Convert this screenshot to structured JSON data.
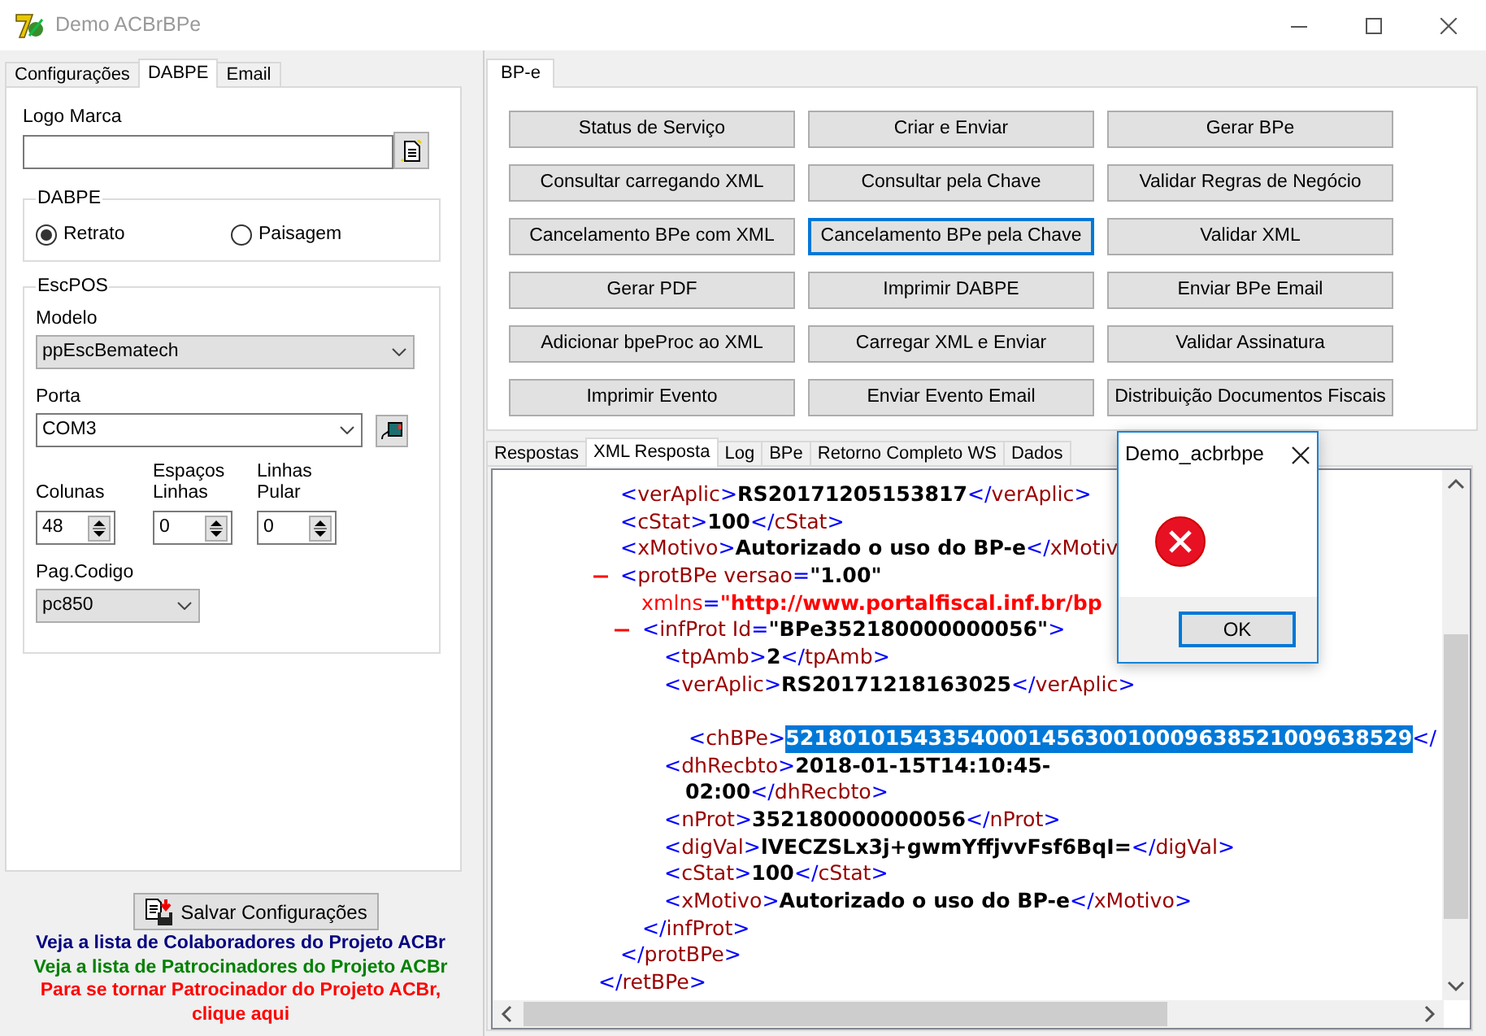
{
  "window": {
    "title": "Demo ACBrBPe",
    "active": false
  },
  "left_tabs": [
    {
      "label": "Configurações",
      "selected": false
    },
    {
      "label": "DABPE",
      "selected": true
    },
    {
      "label": "Email",
      "selected": false
    }
  ],
  "logo_field": {
    "label": "Logo Marca"
  },
  "orientation_group": {
    "title": "DABPE",
    "options": [
      {
        "label": "Retrato",
        "selected": true
      },
      {
        "label": "Paisagem",
        "selected": false
      }
    ]
  },
  "escpos": {
    "title": "EscPOS",
    "modelo": {
      "label": "Modelo",
      "value": "ppEscBematech"
    },
    "porta": {
      "label": "Porta",
      "value": "COM3"
    },
    "spinners": [
      {
        "label": "Colunas",
        "value": "48"
      },
      {
        "label": "Espaços Linhas",
        "value": "0"
      },
      {
        "label": "Linhas Pular",
        "value": "0"
      }
    ],
    "pag_codigo": {
      "label": "Pag.Codigo",
      "value": "pc850"
    }
  },
  "save_button": "Salvar Configurações",
  "links": [
    {
      "text": "Veja a lista de Colaboradores do Projeto ACBr",
      "color": "#000080"
    },
    {
      "text": "Veja a lista de Patrocinadores do Projeto ACBr",
      "color": "#008000"
    },
    {
      "text": "Para se tornar Patrocinador do Projeto ACBr, clique aqui",
      "color": "#ff0000"
    }
  ],
  "bpe_tabs": [
    {
      "label": "BP-e",
      "selected": true
    }
  ],
  "actions": [
    {
      "label": "Status de Serviço",
      "focused": false
    },
    {
      "label": "Criar e Enviar",
      "focused": false
    },
    {
      "label": "Gerar BPe",
      "focused": false
    },
    {
      "label": "Consultar carregando XML",
      "focused": false
    },
    {
      "label": "Consultar pela Chave",
      "focused": false
    },
    {
      "label": "Validar Regras de Negócio",
      "focused": false
    },
    {
      "label": "Cancelamento BPe com XML",
      "focused": false
    },
    {
      "label": "Cancelamento BPe pela Chave",
      "focused": true
    },
    {
      "label": "Validar XML",
      "focused": false
    },
    {
      "label": "Gerar PDF",
      "focused": false
    },
    {
      "label": "Imprimir DABPE",
      "focused": false
    },
    {
      "label": "Enviar BPe Email",
      "focused": false
    },
    {
      "label": "Adicionar bpeProc ao XML",
      "focused": false
    },
    {
      "label": "Carregar XML e Enviar",
      "focused": false
    },
    {
      "label": "Validar Assinatura",
      "focused": false
    },
    {
      "label": "Imprimir Evento",
      "focused": false
    },
    {
      "label": "Enviar Evento Email",
      "focused": false
    },
    {
      "label": "Distribuição Documentos Fiscais",
      "focused": false
    }
  ],
  "result_tabs": [
    {
      "label": "Respostas",
      "selected": false
    },
    {
      "label": "XML Resposta",
      "selected": true
    },
    {
      "label": "Log",
      "selected": false
    },
    {
      "label": "BPe",
      "selected": false
    },
    {
      "label": "Retorno Completo WS",
      "selected": false
    },
    {
      "label": "Dados",
      "selected": false
    }
  ],
  "xml": {
    "children": [
      {
        "lines": [
          [
            {
              "kind": "punct",
              "text": "<"
            },
            {
              "kind": "name",
              "text": "verAplic"
            },
            {
              "kind": "punct",
              "text": ">"
            },
            {
              "kind": "value",
              "text": "RS20171205153817"
            },
            {
              "kind": "punct",
              "text": "</"
            },
            {
              "kind": "name",
              "text": "verAplic"
            },
            {
              "kind": "punct",
              "text": ">"
            }
          ]
        ]
      },
      {
        "lines": [
          [
            {
              "kind": "punct",
              "text": "<"
            },
            {
              "kind": "name",
              "text": "cStat"
            },
            {
              "kind": "punct",
              "text": ">"
            },
            {
              "kind": "value",
              "text": "100"
            },
            {
              "kind": "punct",
              "text": "</"
            },
            {
              "kind": "name",
              "text": "cStat"
            },
            {
              "kind": "punct",
              "text": ">"
            }
          ]
        ]
      },
      {
        "lines": [
          [
            {
              "kind": "punct",
              "text": "<"
            },
            {
              "kind": "name",
              "text": "xMotivo"
            },
            {
              "kind": "punct",
              "text": ">"
            },
            {
              "kind": "value",
              "text": "Autorizado o uso do BP-e"
            },
            {
              "kind": "punct",
              "text": "</"
            },
            {
              "kind": "name",
              "text": "xMotiv"
            }
          ]
        ]
      },
      {
        "expanded": true,
        "lines": [
          [
            {
              "kind": "punct",
              "text": "<"
            },
            {
              "kind": "name",
              "text": "protBPe"
            },
            {
              "kind": "name",
              "text": " versao"
            },
            {
              "kind": "punct",
              "text": "="
            },
            {
              "kind": "value",
              "text": "\"1.00\""
            }
          ],
          [
            {
              "kind": "ns",
              "text": "xmlns"
            },
            {
              "kind": "punct",
              "text": "="
            },
            {
              "kind": "nsvalue",
              "text": "\"http://www.portalfiscal.inf.br/bp"
            }
          ]
        ],
        "children": [
          {
            "expanded": true,
            "lines": [
              [
                {
                  "kind": "punct",
                  "text": "<"
                },
                {
                  "kind": "name",
                  "text": "infProt"
                },
                {
                  "kind": "name",
                  "text": " Id"
                },
                {
                  "kind": "punct",
                  "text": "="
                },
                {
                  "kind": "value",
                  "text": "\"BPe352180000000056\""
                },
                {
                  "kind": "punct",
                  "text": ">"
                }
              ]
            ],
            "children": [
              {
                "lines": [
                  [
                    {
                      "kind": "punct",
                      "text": "<"
                    },
                    {
                      "kind": "name",
                      "text": "tpAmb"
                    },
                    {
                      "kind": "punct",
                      "text": ">"
                    },
                    {
                      "kind": "value",
                      "text": "2"
                    },
                    {
                      "kind": "punct",
                      "text": "</"
                    },
                    {
                      "kind": "name",
                      "text": "tpAmb"
                    },
                    {
                      "kind": "punct",
                      "text": ">"
                    }
                  ]
                ]
              },
              {
                "lines": [
                  [
                    {
                      "kind": "punct",
                      "text": "<"
                    },
                    {
                      "kind": "name",
                      "text": "verAplic"
                    },
                    {
                      "kind": "punct",
                      "text": ">"
                    },
                    {
                      "kind": "value",
                      "text": "RS20171218163025"
                    },
                    {
                      "kind": "punct",
                      "text": "</"
                    },
                    {
                      "kind": "name",
                      "text": "verAplic"
                    },
                    {
                      "kind": "punct",
                      "text": ">"
                    }
                  ]
                ]
              },
              {
                "spaced": true,
                "lines": [
                  [
                    {
                      "kind": "punct",
                      "text": "<"
                    },
                    {
                      "kind": "name",
                      "text": "chBPe"
                    },
                    {
                      "kind": "punct",
                      "text": ">"
                    },
                    {
                      "kind": "selected",
                      "text": "52180101543354000145630010009638521009638529"
                    },
                    {
                      "kind": "punct",
                      "text": "</"
                    }
                  ]
                ]
              },
              {
                "lines": [
                  [
                    {
                      "kind": "punct",
                      "text": "<"
                    },
                    {
                      "kind": "name",
                      "text": "dhRecbto"
                    },
                    {
                      "kind": "punct",
                      "text": ">"
                    },
                    {
                      "kind": "value",
                      "text": "2018-01-15T14:10:45-"
                    }
                  ],
                  [
                    {
                      "kind": "value",
                      "text": "02:00"
                    },
                    {
                      "kind": "punct",
                      "text": "</"
                    },
                    {
                      "kind": "name",
                      "text": "dhRecbto"
                    },
                    {
                      "kind": "punct",
                      "text": ">"
                    }
                  ]
                ]
              },
              {
                "lines": [
                  [
                    {
                      "kind": "punct",
                      "text": "<"
                    },
                    {
                      "kind": "name",
                      "text": "nProt"
                    },
                    {
                      "kind": "punct",
                      "text": ">"
                    },
                    {
                      "kind": "value",
                      "text": "352180000000056"
                    },
                    {
                      "kind": "punct",
                      "text": "</"
                    },
                    {
                      "kind": "name",
                      "text": "nProt"
                    },
                    {
                      "kind": "punct",
                      "text": ">"
                    }
                  ]
                ]
              },
              {
                "lines": [
                  [
                    {
                      "kind": "punct",
                      "text": "<"
                    },
                    {
                      "kind": "name",
                      "text": "digVal"
                    },
                    {
                      "kind": "punct",
                      "text": ">"
                    },
                    {
                      "kind": "value",
                      "text": "lVECZSLx3j+gwmYffjvvFsf6BqI="
                    },
                    {
                      "kind": "punct",
                      "text": "</"
                    },
                    {
                      "kind": "name",
                      "text": "digVal"
                    },
                    {
                      "kind": "punct",
                      "text": ">"
                    }
                  ]
                ]
              },
              {
                "lines": [
                  [
                    {
                      "kind": "punct",
                      "text": "<"
                    },
                    {
                      "kind": "name",
                      "text": "cStat"
                    },
                    {
                      "kind": "punct",
                      "text": ">"
                    },
                    {
                      "kind": "value",
                      "text": "100"
                    },
                    {
                      "kind": "punct",
                      "text": "</"
                    },
                    {
                      "kind": "name",
                      "text": "cStat"
                    },
                    {
                      "kind": "punct",
                      "text": ">"
                    }
                  ]
                ]
              },
              {
                "lines": [
                  [
                    {
                      "kind": "punct",
                      "text": "<"
                    },
                    {
                      "kind": "name",
                      "text": "xMotivo"
                    },
                    {
                      "kind": "punct",
                      "text": ">"
                    },
                    {
                      "kind": "value",
                      "text": "Autorizado o uso do BP-e"
                    },
                    {
                      "kind": "punct",
                      "text": "</"
                    },
                    {
                      "kind": "name",
                      "text": "xMotivo"
                    },
                    {
                      "kind": "punct",
                      "text": ">"
                    }
                  ]
                ]
              }
            ],
            "close": [
              {
                "kind": "punct",
                "text": "</"
              },
              {
                "kind": "name",
                "text": "infProt"
              },
              {
                "kind": "punct",
                "text": ">"
              }
            ]
          }
        ],
        "close": [
          {
            "kind": "punct",
            "text": "</"
          },
          {
            "kind": "name",
            "text": "protBPe"
          },
          {
            "kind": "punct",
            "text": ">"
          }
        ]
      }
    ],
    "close": [
      {
        "kind": "punct",
        "text": "</"
      },
      {
        "kind": "name",
        "text": "retBPe"
      },
      {
        "kind": "punct",
        "text": ">"
      }
    ]
  },
  "dialog": {
    "title": "Demo_acbrbpe",
    "button": "OK"
  }
}
